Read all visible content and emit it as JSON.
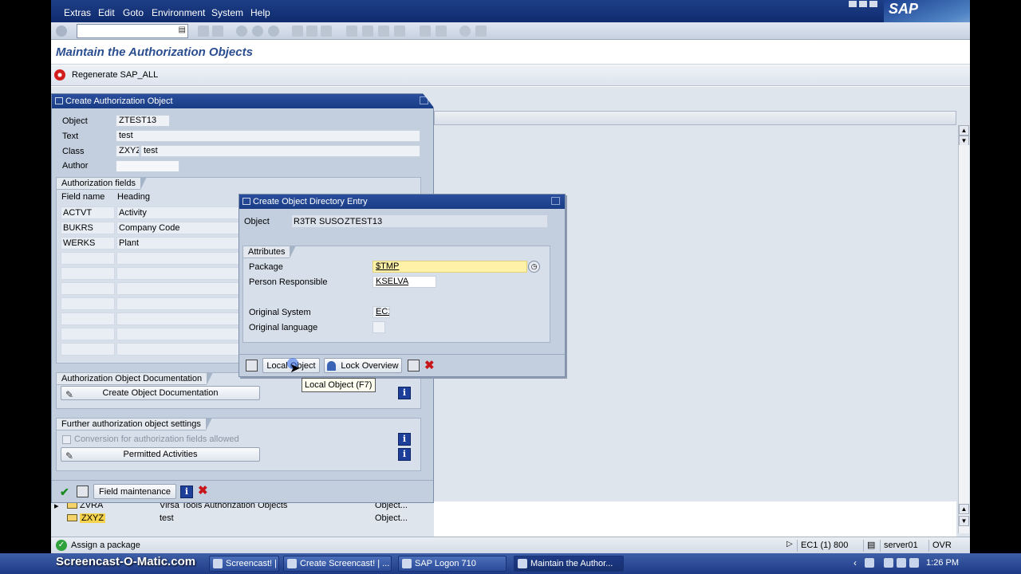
{
  "menu": [
    "Extras",
    "Edit",
    "Goto",
    "Environment",
    "System",
    "Help"
  ],
  "brand": "SAP",
  "page_title": "Maintain the Authorization Objects",
  "app_toolbar": {
    "regenerate_label": "Regenerate SAP_ALL"
  },
  "create_auth_dialog": {
    "title": "Create Authorization Object",
    "object_label": "Object",
    "object_value": "ZTEST13",
    "text_label": "Text",
    "text_value": "test",
    "class_label": "Class",
    "class_code": "ZXYZ",
    "class_text": "test",
    "author_label": "Author",
    "author_value": "",
    "fields_section": "Authorization fields",
    "col_field": "Field name",
    "col_heading": "Heading",
    "rows": [
      {
        "field": "ACTVT",
        "heading": "Activity"
      },
      {
        "field": "BUKRS",
        "heading": "Company Code"
      },
      {
        "field": "WERKS",
        "heading": "Plant"
      }
    ],
    "doc_section": "Authorization Object Documentation",
    "create_doc_label": "Create Object Documentation",
    "further_section": "Further authorization object settings",
    "conversion_label": "Conversion for authorization fields allowed",
    "permitted_label": "Permitted Activities",
    "field_maintenance_label": "Field maintenance"
  },
  "directory_dialog": {
    "title": "Create Object Directory Entry",
    "object_label": "Object",
    "object_pgmid": "R3TR",
    "object_type": "SUSO",
    "object_name": "ZTEST13",
    "attributes_section": "Attributes",
    "package_label": "Package",
    "package_value": "$TMP",
    "person_label": "Person Responsible",
    "person_value": "KSELVA",
    "system_label": "Original System",
    "system_value": "EC1",
    "language_label": "Original language",
    "language_value": "",
    "local_object_label": "Local Object",
    "lock_overview_label": "Lock Overview"
  },
  "tooltip": "Local Object   (F7)",
  "tree_rows": [
    {
      "name": "ZVRA",
      "desc": "Virsa Tools Authorization Objects",
      "type": "Object..."
    },
    {
      "name": "ZXYZ",
      "desc": "test",
      "type": "Object..."
    }
  ],
  "status": {
    "message": "Assign a package",
    "system": "EC1 (1) 800",
    "server": "server01",
    "mode": "OVR"
  },
  "taskbar": {
    "watermark": "Screencast-O-Matic.com",
    "tasks": [
      "Screencast! | ...",
      "Create Screencast! | ...",
      "SAP Logon 710",
      "Maintain the Author..."
    ],
    "clock": "1:26 PM"
  },
  "colors": {
    "title_blue": "#2b4e91",
    "dialog_bg": "#c3cfdf",
    "package_highlight": "#fff2a8"
  }
}
